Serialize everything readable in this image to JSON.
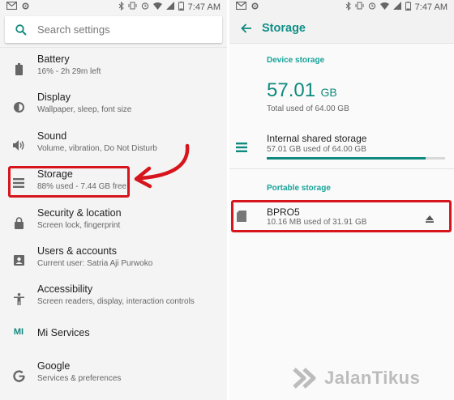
{
  "status": {
    "time": "7:47 AM"
  },
  "settings": {
    "search_placeholder": "Search settings",
    "items": [
      {
        "title": "Battery",
        "subtitle": "16% - 2h 29m left"
      },
      {
        "title": "Display",
        "subtitle": "Wallpaper, sleep, font size"
      },
      {
        "title": "Sound",
        "subtitle": "Volume, vibration, Do Not Disturb"
      },
      {
        "title": "Storage",
        "subtitle": "88% used - 7.44 GB free"
      },
      {
        "title": "Security & location",
        "subtitle": "Screen lock, fingerprint"
      },
      {
        "title": "Users & accounts",
        "subtitle": "Current user: Satria Aji Purwoko"
      },
      {
        "title": "Accessibility",
        "subtitle": "Screen readers, display, interaction controls"
      },
      {
        "title": "Mi Services",
        "subtitle": ""
      },
      {
        "title": "Google",
        "subtitle": "Services & preferences"
      }
    ],
    "mi_icon_text": "MI"
  },
  "storage": {
    "title": "Storage",
    "device_header": "Device storage",
    "total_value": "57.01",
    "total_unit": "GB",
    "total_caption": "Total used of 64.00 GB",
    "internal_title": "Internal shared storage",
    "internal_subtitle": "57.01 GB used of 64.00 GB",
    "internal_fraction": 0.891,
    "portable_header": "Portable storage",
    "portable_title": "BPRO5",
    "portable_subtitle": "10.16 MB used of 31.91 GB"
  },
  "watermark": "JalanTikus",
  "colors": {
    "accent": "#10897f",
    "highlight": "#d6151d"
  }
}
